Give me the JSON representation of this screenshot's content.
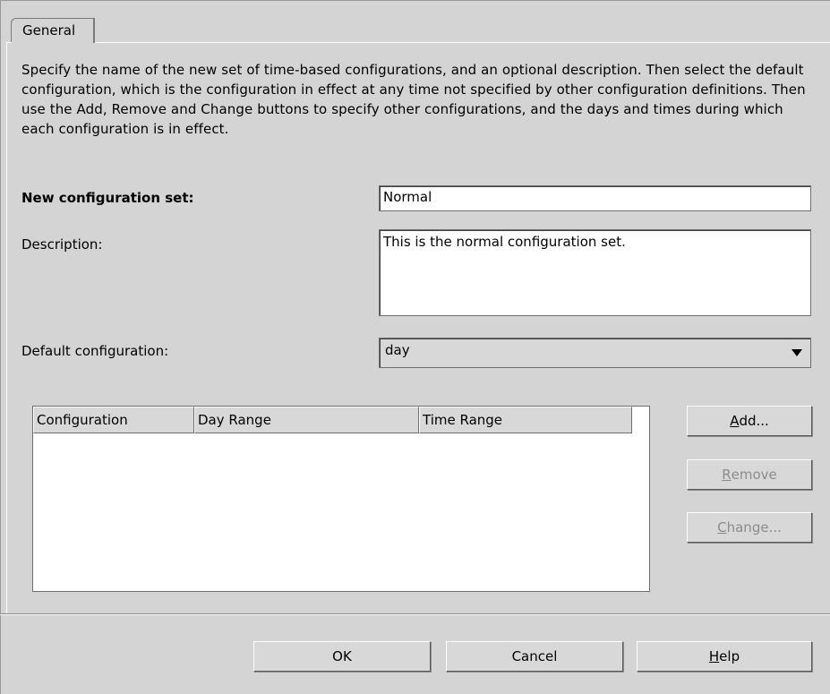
{
  "tab": {
    "label": "General"
  },
  "instructions": "Specify the name of the new set of time-based configurations, and an optional description. Then select the default configuration, which is the configuration in effect at any time not specified by other configuration definitions. Then use the Add, Remove and Change buttons to specify other configurations, and the days and times during which each configuration is in effect.",
  "form": {
    "name_label": "New configuration set:",
    "name_value": "Normal",
    "description_label": "Description:",
    "description_value": "This is the normal configuration set.",
    "default_label": "Default configuration:",
    "default_value": "day"
  },
  "table": {
    "columns": [
      "Configuration",
      "Day Range",
      "Time Range"
    ],
    "rows": []
  },
  "side_buttons": {
    "add": {
      "prefix": "",
      "mnemonic": "A",
      "suffix": "dd...",
      "enabled": true
    },
    "remove": {
      "prefix": "",
      "mnemonic": "R",
      "suffix": "emove",
      "enabled": false
    },
    "change": {
      "prefix": "",
      "mnemonic": "C",
      "suffix": "hange...",
      "enabled": false
    }
  },
  "footer_buttons": {
    "ok": "OK",
    "cancel": "Cancel",
    "help": {
      "mnemonic": "H",
      "suffix": "elp"
    }
  }
}
